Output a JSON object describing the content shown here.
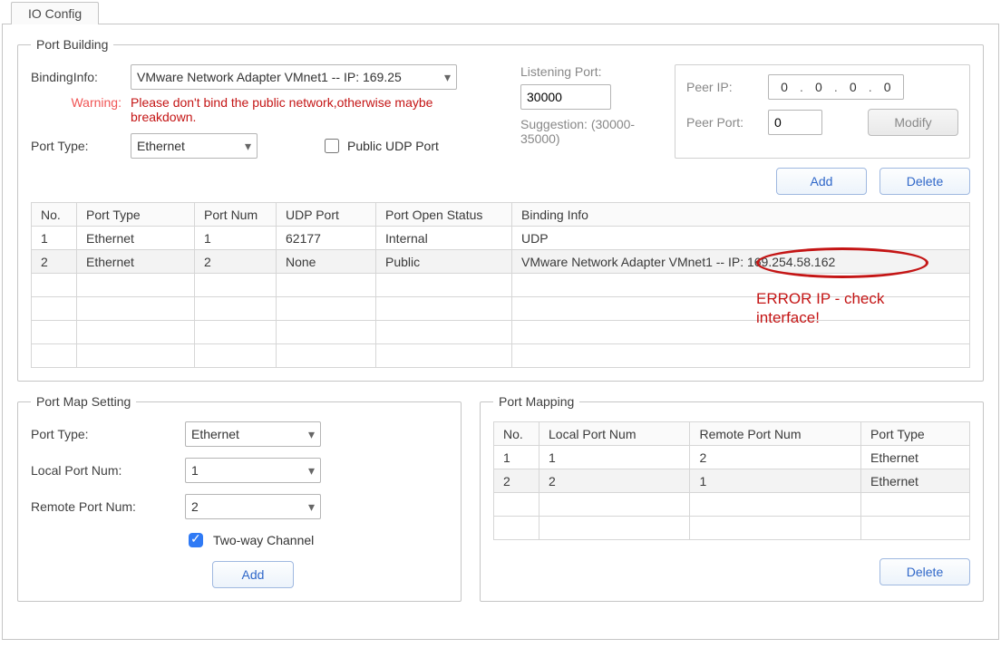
{
  "tab_label": "IO Config",
  "port_building": {
    "legend": "Port Building",
    "labels": {
      "binding_info": "BindingInfo:",
      "warning_label": "Warning:",
      "warning_text": "Please don't bind the public network,otherwise maybe breakdown.",
      "port_type": "Port Type:",
      "public_udp": "Public UDP Port",
      "listening_port": "Listening Port:",
      "suggestion": "Suggestion: (30000-35000)",
      "peer_ip": "Peer IP:",
      "peer_port": "Peer Port:"
    },
    "binding_info_value": "VMware Network Adapter VMnet1 -- IP: 169.25",
    "port_type_value": "Ethernet",
    "public_udp_checked": false,
    "listening_port_value": "30000",
    "peer_ip_octets": [
      "0",
      "0",
      "0",
      "0"
    ],
    "peer_port_value": "0",
    "buttons": {
      "modify": "Modify",
      "add": "Add",
      "delete": "Delete"
    },
    "table": {
      "headers": [
        "No.",
        "Port Type",
        "Port Num",
        "UDP Port",
        "Port Open Status",
        "Binding Info"
      ],
      "rows": [
        [
          "1",
          "Ethernet",
          "1",
          "62177",
          "Internal",
          "UDP"
        ],
        [
          "2",
          "Ethernet",
          "2",
          "None",
          "Public",
          "VMware Network Adapter VMnet1 -- IP: 169.254.58.162"
        ]
      ]
    }
  },
  "port_map_setting": {
    "legend": "Port Map Setting",
    "labels": {
      "port_type": "Port Type:",
      "local_port": "Local Port Num:",
      "remote_port": "Remote Port Num:",
      "two_way": "Two-way Channel"
    },
    "port_type_value": "Ethernet",
    "local_port_value": "1",
    "remote_port_value": "2",
    "two_way_checked": true,
    "buttons": {
      "add": "Add"
    }
  },
  "port_mapping": {
    "legend": "Port Mapping",
    "table": {
      "headers": [
        "No.",
        "Local Port Num",
        "Remote Port Num",
        "Port Type"
      ],
      "rows": [
        [
          "1",
          "1",
          "2",
          "Ethernet"
        ],
        [
          "2",
          "2",
          "1",
          "Ethernet"
        ]
      ]
    },
    "buttons": {
      "delete": "Delete"
    }
  },
  "annotation": {
    "text": "ERROR IP - check interface!"
  }
}
